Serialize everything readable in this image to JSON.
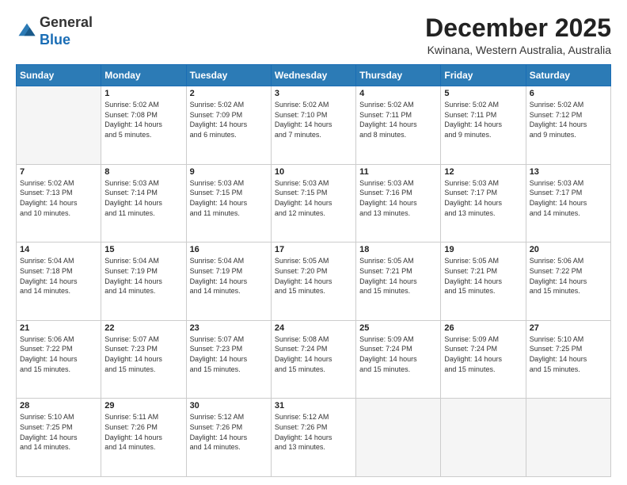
{
  "header": {
    "logo_general": "General",
    "logo_blue": "Blue",
    "month_title": "December 2025",
    "location": "Kwinana, Western Australia, Australia"
  },
  "days_of_week": [
    "Sunday",
    "Monday",
    "Tuesday",
    "Wednesday",
    "Thursday",
    "Friday",
    "Saturday"
  ],
  "weeks": [
    [
      {
        "day": "",
        "info": ""
      },
      {
        "day": "1",
        "info": "Sunrise: 5:02 AM\nSunset: 7:08 PM\nDaylight: 14 hours\nand 5 minutes."
      },
      {
        "day": "2",
        "info": "Sunrise: 5:02 AM\nSunset: 7:09 PM\nDaylight: 14 hours\nand 6 minutes."
      },
      {
        "day": "3",
        "info": "Sunrise: 5:02 AM\nSunset: 7:10 PM\nDaylight: 14 hours\nand 7 minutes."
      },
      {
        "day": "4",
        "info": "Sunrise: 5:02 AM\nSunset: 7:11 PM\nDaylight: 14 hours\nand 8 minutes."
      },
      {
        "day": "5",
        "info": "Sunrise: 5:02 AM\nSunset: 7:11 PM\nDaylight: 14 hours\nand 9 minutes."
      },
      {
        "day": "6",
        "info": "Sunrise: 5:02 AM\nSunset: 7:12 PM\nDaylight: 14 hours\nand 9 minutes."
      }
    ],
    [
      {
        "day": "7",
        "info": "Sunrise: 5:02 AM\nSunset: 7:13 PM\nDaylight: 14 hours\nand 10 minutes."
      },
      {
        "day": "8",
        "info": "Sunrise: 5:03 AM\nSunset: 7:14 PM\nDaylight: 14 hours\nand 11 minutes."
      },
      {
        "day": "9",
        "info": "Sunrise: 5:03 AM\nSunset: 7:15 PM\nDaylight: 14 hours\nand 11 minutes."
      },
      {
        "day": "10",
        "info": "Sunrise: 5:03 AM\nSunset: 7:15 PM\nDaylight: 14 hours\nand 12 minutes."
      },
      {
        "day": "11",
        "info": "Sunrise: 5:03 AM\nSunset: 7:16 PM\nDaylight: 14 hours\nand 13 minutes."
      },
      {
        "day": "12",
        "info": "Sunrise: 5:03 AM\nSunset: 7:17 PM\nDaylight: 14 hours\nand 13 minutes."
      },
      {
        "day": "13",
        "info": "Sunrise: 5:03 AM\nSunset: 7:17 PM\nDaylight: 14 hours\nand 14 minutes."
      }
    ],
    [
      {
        "day": "14",
        "info": "Sunrise: 5:04 AM\nSunset: 7:18 PM\nDaylight: 14 hours\nand 14 minutes."
      },
      {
        "day": "15",
        "info": "Sunrise: 5:04 AM\nSunset: 7:19 PM\nDaylight: 14 hours\nand 14 minutes."
      },
      {
        "day": "16",
        "info": "Sunrise: 5:04 AM\nSunset: 7:19 PM\nDaylight: 14 hours\nand 14 minutes."
      },
      {
        "day": "17",
        "info": "Sunrise: 5:05 AM\nSunset: 7:20 PM\nDaylight: 14 hours\nand 15 minutes."
      },
      {
        "day": "18",
        "info": "Sunrise: 5:05 AM\nSunset: 7:21 PM\nDaylight: 14 hours\nand 15 minutes."
      },
      {
        "day": "19",
        "info": "Sunrise: 5:05 AM\nSunset: 7:21 PM\nDaylight: 14 hours\nand 15 minutes."
      },
      {
        "day": "20",
        "info": "Sunrise: 5:06 AM\nSunset: 7:22 PM\nDaylight: 14 hours\nand 15 minutes."
      }
    ],
    [
      {
        "day": "21",
        "info": "Sunrise: 5:06 AM\nSunset: 7:22 PM\nDaylight: 14 hours\nand 15 minutes."
      },
      {
        "day": "22",
        "info": "Sunrise: 5:07 AM\nSunset: 7:23 PM\nDaylight: 14 hours\nand 15 minutes."
      },
      {
        "day": "23",
        "info": "Sunrise: 5:07 AM\nSunset: 7:23 PM\nDaylight: 14 hours\nand 15 minutes."
      },
      {
        "day": "24",
        "info": "Sunrise: 5:08 AM\nSunset: 7:24 PM\nDaylight: 14 hours\nand 15 minutes."
      },
      {
        "day": "25",
        "info": "Sunrise: 5:09 AM\nSunset: 7:24 PM\nDaylight: 14 hours\nand 15 minutes."
      },
      {
        "day": "26",
        "info": "Sunrise: 5:09 AM\nSunset: 7:24 PM\nDaylight: 14 hours\nand 15 minutes."
      },
      {
        "day": "27",
        "info": "Sunrise: 5:10 AM\nSunset: 7:25 PM\nDaylight: 14 hours\nand 15 minutes."
      }
    ],
    [
      {
        "day": "28",
        "info": "Sunrise: 5:10 AM\nSunset: 7:25 PM\nDaylight: 14 hours\nand 14 minutes."
      },
      {
        "day": "29",
        "info": "Sunrise: 5:11 AM\nSunset: 7:26 PM\nDaylight: 14 hours\nand 14 minutes."
      },
      {
        "day": "30",
        "info": "Sunrise: 5:12 AM\nSunset: 7:26 PM\nDaylight: 14 hours\nand 14 minutes."
      },
      {
        "day": "31",
        "info": "Sunrise: 5:12 AM\nSunset: 7:26 PM\nDaylight: 14 hours\nand 13 minutes."
      },
      {
        "day": "",
        "info": ""
      },
      {
        "day": "",
        "info": ""
      },
      {
        "day": "",
        "info": ""
      }
    ]
  ]
}
